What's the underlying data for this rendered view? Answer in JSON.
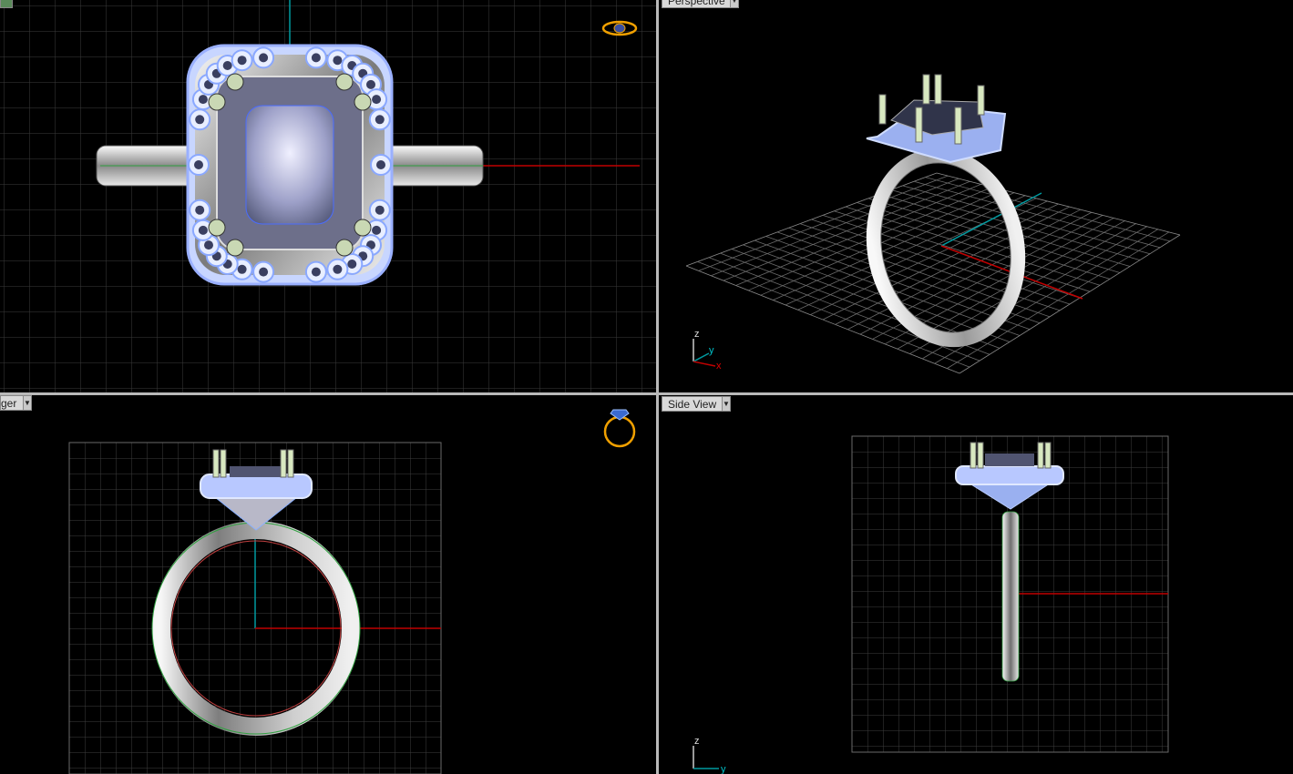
{
  "viewports": {
    "top": {
      "label": "",
      "icon": "ring-top-icon"
    },
    "perspective": {
      "label": "Perspective",
      "axis_z": "z",
      "axis_y": "y",
      "axis_x": "x"
    },
    "finger": {
      "label": "ger",
      "icon": "ring-front-icon"
    },
    "side": {
      "label": "Side View",
      "axis_z": "z",
      "axis_y": "y"
    }
  },
  "colors": {
    "grid": "#3a3a3a",
    "gridMajor": "#5a5a5a",
    "axisX": "#c00000",
    "axisY": "#009aa0",
    "metal": "#d8d8d8",
    "stone": "#a9c4ff",
    "icon": "#f0a000",
    "label_bg": "#d9d9d9"
  }
}
